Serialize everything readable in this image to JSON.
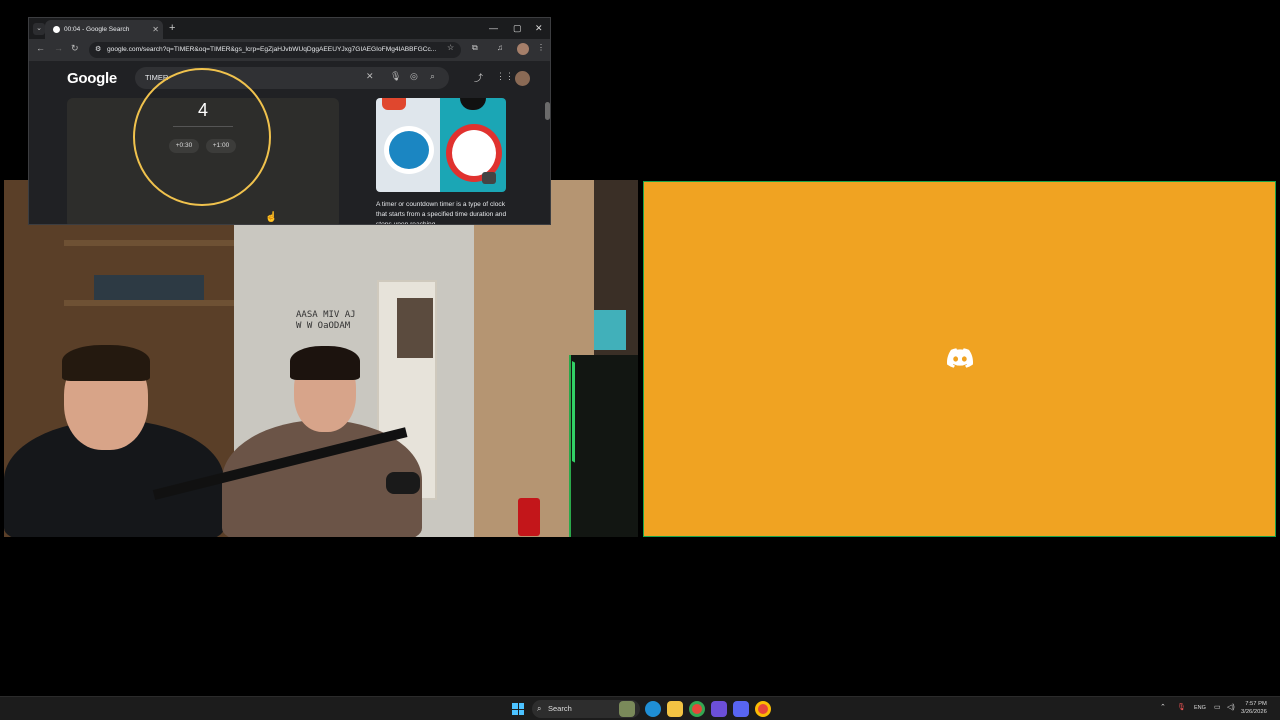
{
  "browser": {
    "tab_title": "00:04 - Google Search",
    "url": "google.com/search?q=TIMER&oq=TIMER&gs_lcrp=EgZjaHJvbWUqDggAEEUYJxg7GIAEGIoFMg4IABBFGCc...",
    "new_tab_glyph": "+",
    "close_glyph": "✕"
  },
  "google": {
    "logo": "Google",
    "search_query": "TIMER",
    "timer_value": "4",
    "add_30s": "+0:30",
    "add_1min": "+1:00",
    "play_glyph": "▶",
    "knowledge_desc": "A timer or countdown timer is a type of clock that starts from a specified time duration and stops upon reaching..."
  },
  "webcam": {
    "wall_text": "AASA MIV AJ\nW W OaODAM"
  },
  "discord_tile": {
    "accent": "#f0a322",
    "icon": "discord-icon"
  },
  "taskbar": {
    "search_label": "Search",
    "lang": "ENG",
    "time": "7:57 PM",
    "date": "3/26/2026"
  }
}
